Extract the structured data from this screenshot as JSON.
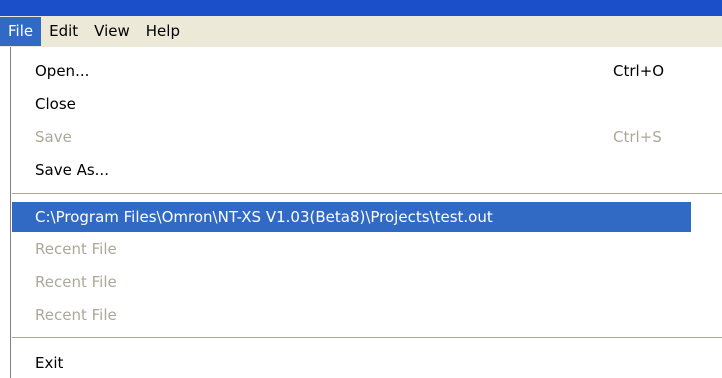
{
  "menubar": {
    "items": [
      {
        "label": "File"
      },
      {
        "label": "Edit"
      },
      {
        "label": "View"
      },
      {
        "label": "Help"
      }
    ]
  },
  "file_menu": {
    "open": {
      "label": "Open...",
      "shortcut": "Ctrl+O"
    },
    "close": {
      "label": "Close"
    },
    "save": {
      "label": "Save",
      "shortcut": "Ctrl+S"
    },
    "save_as": {
      "label": "Save As..."
    },
    "recent": [
      {
        "label": "C:\\Program Files\\Omron\\NT-XS V1.03(Beta8)\\Projects\\test.out"
      },
      {
        "label": "Recent File"
      },
      {
        "label": "Recent File"
      },
      {
        "label": "Recent File"
      }
    ],
    "exit": {
      "label": "Exit"
    }
  },
  "colors": {
    "highlight": "#316ac5",
    "menubar_bg": "#ece9d8",
    "disabled_text": "#aca899",
    "titlebar": "#1b4fc9"
  }
}
